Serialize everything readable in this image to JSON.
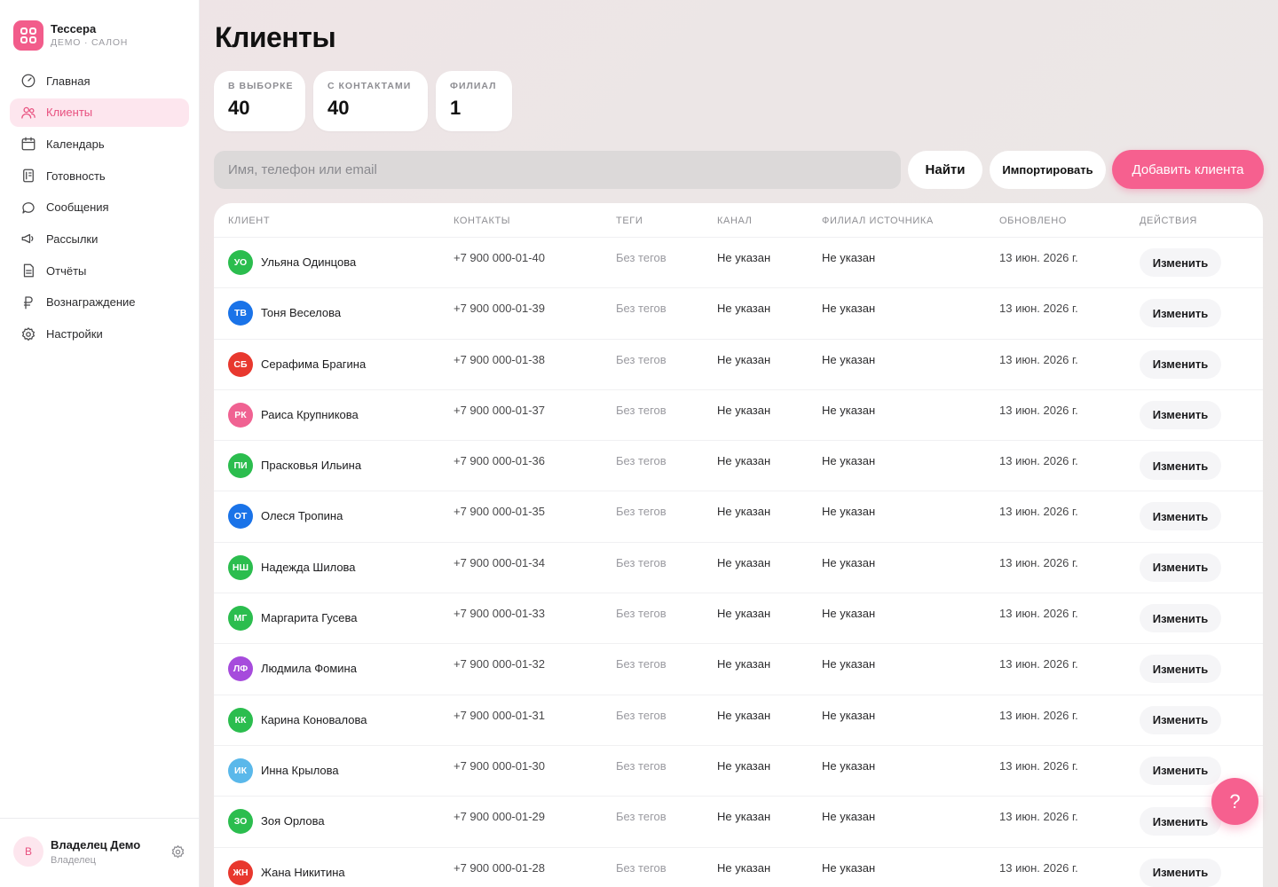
{
  "brand": {
    "name": "Тессера",
    "subtitle": "ДЕМО · САЛОН",
    "color": "#f25c8b"
  },
  "nav": [
    {
      "label": "Главная",
      "icon": "gauge-icon",
      "active": false
    },
    {
      "label": "Клиенты",
      "icon": "users-icon",
      "active": true
    },
    {
      "label": "Календарь",
      "icon": "calendar-icon",
      "active": false
    },
    {
      "label": "Готовность",
      "icon": "checklist-icon",
      "active": false
    },
    {
      "label": "Сообщения",
      "icon": "chat-icon",
      "active": false
    },
    {
      "label": "Рассылки",
      "icon": "megaphone-icon",
      "active": false
    },
    {
      "label": "Отчёты",
      "icon": "report-icon",
      "active": false
    },
    {
      "label": "Вознаграждение",
      "icon": "ruble-icon",
      "active": false
    },
    {
      "label": "Настройки",
      "icon": "gear-icon",
      "active": false
    }
  ],
  "user": {
    "initial": "В",
    "name": "Владелец Демо",
    "role": "Владелец"
  },
  "page": {
    "title": "Клиенты"
  },
  "stats": [
    {
      "label": "В ВЫБОРКЕ",
      "value": "40"
    },
    {
      "label": "С КОНТАКТАМИ",
      "value": "40"
    },
    {
      "label": "ФИЛИАЛ",
      "value": "1"
    }
  ],
  "search": {
    "placeholder": "Имя, телефон или email",
    "find_label": "Найти",
    "import_label": "Импортировать",
    "add_label": "Добавить клиента"
  },
  "table": {
    "headers": {
      "client": "КЛИЕНТ",
      "contacts": "КОНТАКТЫ",
      "tags": "ТЕГИ",
      "channel": "КАНАЛ",
      "branch": "ФИЛИАЛ ИСТОЧНИКА",
      "updated": "ОБНОВЛЕНО",
      "actions": "ДЕЙСТВИЯ"
    },
    "rows": [
      {
        "initials": "УО",
        "color": "#2bbd4e",
        "name": "Ульяна Одинцова",
        "phone": "+7 900 000-01-40",
        "tags": "Без тегов",
        "channel": "Не указан",
        "branch": "Не указан",
        "updated": "13 июн. 2026 г.",
        "action": "Изменить"
      },
      {
        "initials": "ТВ",
        "color": "#1a73e8",
        "name": "Тоня Веселова",
        "phone": "+7 900 000-01-39",
        "tags": "Без тегов",
        "channel": "Не указан",
        "branch": "Не указан",
        "updated": "13 июн. 2026 г.",
        "action": "Изменить"
      },
      {
        "initials": "СБ",
        "color": "#e8382e",
        "name": "Серафима Брагина",
        "phone": "+7 900 000-01-38",
        "tags": "Без тегов",
        "channel": "Не указан",
        "branch": "Не указан",
        "updated": "13 июн. 2026 г.",
        "action": "Изменить"
      },
      {
        "initials": "РК",
        "color": "#f06292",
        "name": "Раиса Крупникова",
        "phone": "+7 900 000-01-37",
        "tags": "Без тегов",
        "channel": "Не указан",
        "branch": "Не указан",
        "updated": "13 июн. 2026 г.",
        "action": "Изменить"
      },
      {
        "initials": "ПИ",
        "color": "#2bbd4e",
        "name": "Прасковья Ильина",
        "phone": "+7 900 000-01-36",
        "tags": "Без тегов",
        "channel": "Не указан",
        "branch": "Не указан",
        "updated": "13 июн. 2026 г.",
        "action": "Изменить"
      },
      {
        "initials": "ОТ",
        "color": "#1a73e8",
        "name": "Олеся Тропина",
        "phone": "+7 900 000-01-35",
        "tags": "Без тегов",
        "channel": "Не указан",
        "branch": "Не указан",
        "updated": "13 июн. 2026 г.",
        "action": "Изменить"
      },
      {
        "initials": "НШ",
        "color": "#2bbd4e",
        "name": "Надежда Шилова",
        "phone": "+7 900 000-01-34",
        "tags": "Без тегов",
        "channel": "Не указан",
        "branch": "Не указан",
        "updated": "13 июн. 2026 г.",
        "action": "Изменить"
      },
      {
        "initials": "МГ",
        "color": "#2bbd4e",
        "name": "Маргарита Гусева",
        "phone": "+7 900 000-01-33",
        "tags": "Без тегов",
        "channel": "Не указан",
        "branch": "Не указан",
        "updated": "13 июн. 2026 г.",
        "action": "Изменить"
      },
      {
        "initials": "ЛФ",
        "color": "#a64bdc",
        "name": "Людмила Фомина",
        "phone": "+7 900 000-01-32",
        "tags": "Без тегов",
        "channel": "Не указан",
        "branch": "Не указан",
        "updated": "13 июн. 2026 г.",
        "action": "Изменить"
      },
      {
        "initials": "КК",
        "color": "#2bbd4e",
        "name": "Карина Коновалова",
        "phone": "+7 900 000-01-31",
        "tags": "Без тегов",
        "channel": "Не указан",
        "branch": "Не указан",
        "updated": "13 июн. 2026 г.",
        "action": "Изменить"
      },
      {
        "initials": "ИК",
        "color": "#5ab8ea",
        "name": "Инна Крылова",
        "phone": "+7 900 000-01-30",
        "tags": "Без тегов",
        "channel": "Не указан",
        "branch": "Не указан",
        "updated": "13 июн. 2026 г.",
        "action": "Изменить"
      },
      {
        "initials": "ЗО",
        "color": "#2bbd4e",
        "name": "Зоя Орлова",
        "phone": "+7 900 000-01-29",
        "tags": "Без тегов",
        "channel": "Не указан",
        "branch": "Не указан",
        "updated": "13 июн. 2026 г.",
        "action": "Изменить"
      },
      {
        "initials": "ЖН",
        "color": "#e8382e",
        "name": "Жана Никитина",
        "phone": "+7 900 000-01-28",
        "tags": "Без тегов",
        "channel": "Не указан",
        "branch": "Не указан",
        "updated": "13 июн. 2026 г.",
        "action": "Изменить"
      }
    ]
  },
  "help": {
    "label": "?"
  },
  "colors": {
    "accent": "#f6608f",
    "active_nav_bg": "#fde6ee",
    "active_nav_text": "#e8507f"
  }
}
